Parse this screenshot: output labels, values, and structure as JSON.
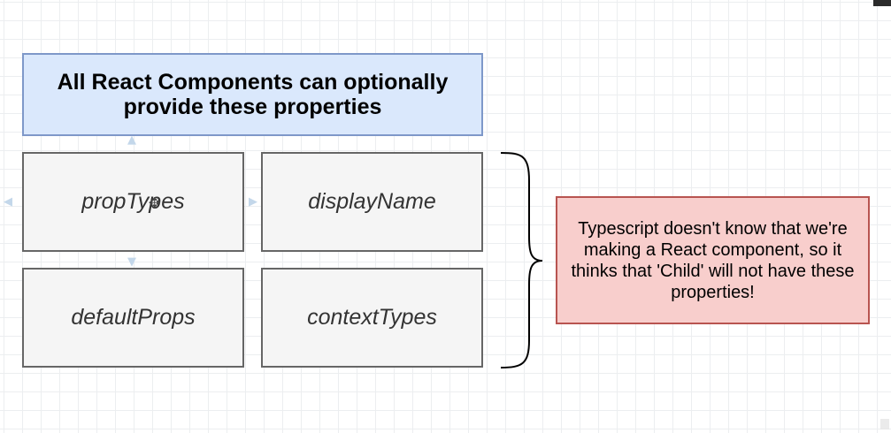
{
  "diagram": {
    "title": "All React Components can optionally provide these properties",
    "properties": [
      {
        "label": "propTypes"
      },
      {
        "label": "displayName"
      },
      {
        "label": "defaultProps"
      },
      {
        "label": "contextTypes"
      }
    ],
    "note": "Typescript doesn't know that we're making a React component, so it thinks that 'Child' will not have these properties!"
  },
  "colors": {
    "title_fill": "#dae8fc",
    "title_stroke": "#7e98c9",
    "property_fill": "#f5f5f5",
    "property_stroke": "#666666",
    "note_fill": "#f8cecc",
    "note_stroke": "#b85450",
    "brace_stroke": "#000000"
  },
  "icons": {
    "connection_hints": "arrow-icon",
    "cursor": "move-cursor-icon"
  }
}
